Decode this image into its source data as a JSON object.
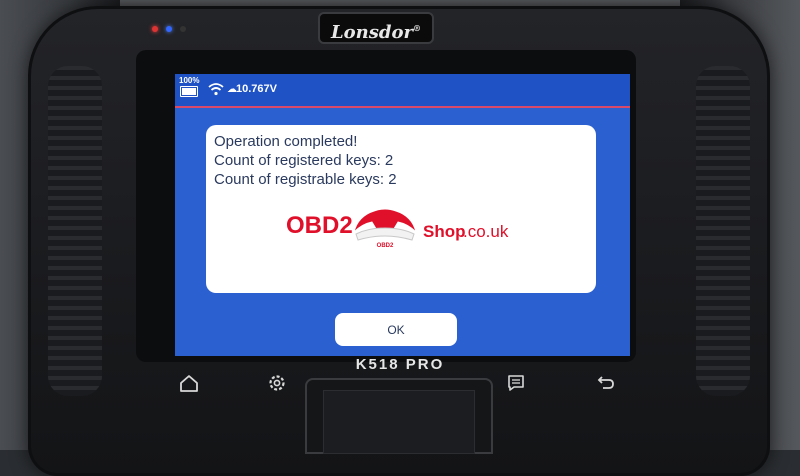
{
  "device": {
    "brand": "Lonsdor",
    "model": "K518 PRO"
  },
  "statusbar": {
    "battery": "100%",
    "voltage": "10.767V",
    "icons": [
      "battery-icon",
      "wifi-icon",
      "voltage-icon"
    ]
  },
  "dialog": {
    "lines": [
      "Operation completed!",
      "Count of registered keys: 2",
      "Count of registrable keys: 2"
    ],
    "ok_label": "OK"
  },
  "watermark": {
    "obd2": "OBD2",
    "shop": "Shop",
    "domain": ".co.uk",
    "car_badge": "OBD2"
  },
  "nav": [
    "home-icon",
    "settings-icon",
    "message-icon",
    "back-icon"
  ],
  "colors": {
    "screen": "#2b60d0",
    "dialog": "#ffffff",
    "watermark": "#e0102a"
  }
}
